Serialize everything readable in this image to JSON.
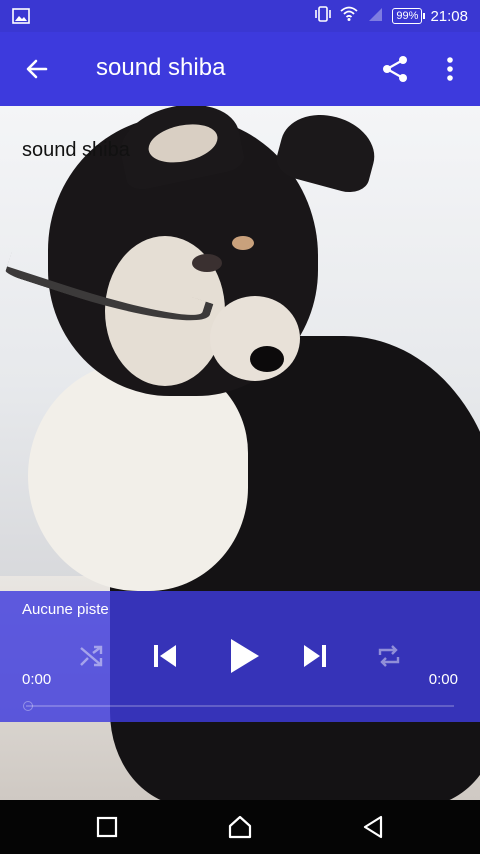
{
  "status_bar": {
    "time": "21:08",
    "battery": "99%",
    "icons": [
      "image-icon",
      "vibrate-icon",
      "wifi-icon",
      "signal-icon",
      "battery-icon"
    ]
  },
  "app_bar": {
    "title": "sound shiba",
    "icons": [
      "back-arrow-icon",
      "share-icon",
      "more-vert-icon"
    ]
  },
  "content": {
    "label": "sound shiba"
  },
  "player": {
    "track": "Aucune piste",
    "time_elapsed": "0:00",
    "time_total": "0:00",
    "progress": 0,
    "controls": [
      "shuffle-icon",
      "skip-previous-icon",
      "play-icon",
      "skip-next-icon",
      "repeat-icon"
    ]
  },
  "nav_bar": {
    "icons": [
      "recent-apps-icon",
      "home-icon",
      "back-icon"
    ]
  },
  "colors": {
    "primary": "#3d3add",
    "status_bar": "#3a37d2",
    "player_overlay": "#3e3add"
  }
}
